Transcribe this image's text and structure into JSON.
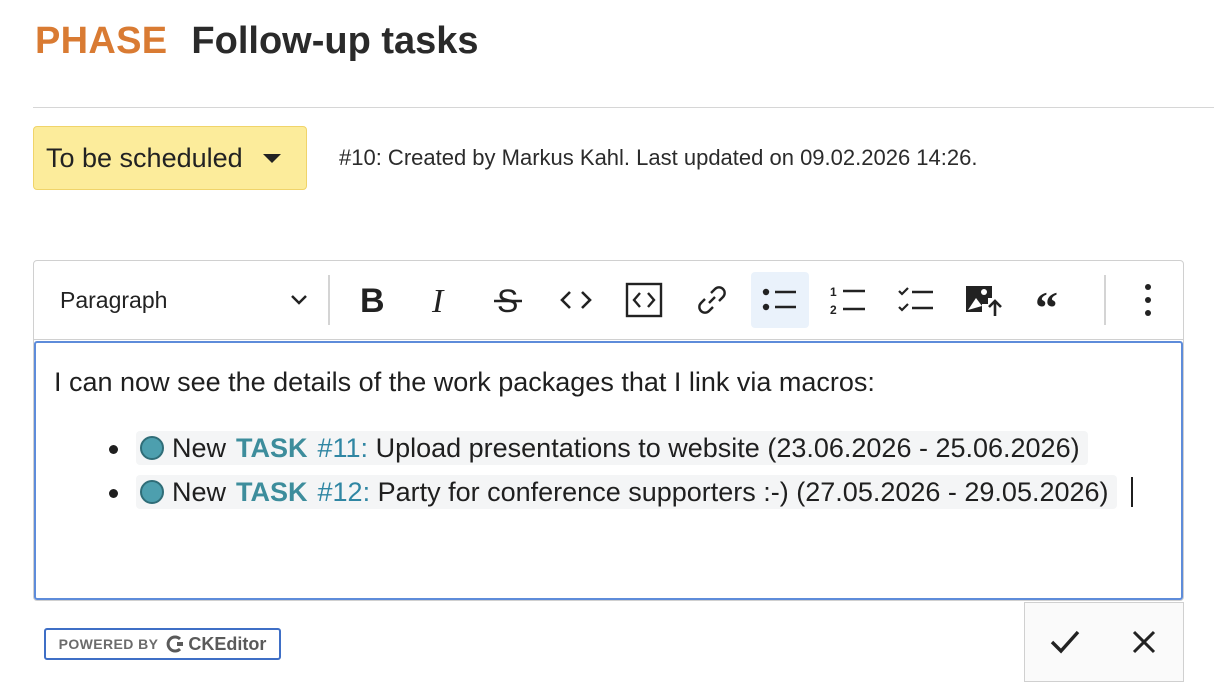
{
  "header": {
    "phase": "PHASE",
    "title": "Follow-up tasks"
  },
  "status": {
    "label": "To be scheduled",
    "color": "#fcec9b"
  },
  "meta": {
    "text": "#10: Created by Markus Kahl. Last updated on 09.02.2026 14:26."
  },
  "toolbar": {
    "paragraph_label": "Paragraph",
    "buttons": [
      "bold-icon",
      "italic-icon",
      "strikethrough-icon",
      "code-icon",
      "code-block-icon",
      "link-icon",
      "bulleted-list-icon",
      "numbered-list-icon",
      "todo-list-icon",
      "image-upload-icon",
      "blockquote-icon",
      "more-icon"
    ],
    "active": "bulleted-list-icon"
  },
  "content": {
    "intro": "I can now see the details of the work packages that I link via macros:",
    "items": [
      {
        "status": "New",
        "type": "TASK",
        "number": "#11:",
        "subject": "Upload presentations to website",
        "dates": "(23.06.2026 - 25.06.2026)"
      },
      {
        "status": "New",
        "type": "TASK",
        "number": "#12:",
        "subject": "Party for conference supporters :-)",
        "dates": "(27.05.2026 - 29.05.2026)"
      }
    ],
    "status_color": "#4d9fae"
  },
  "footer": {
    "powered_by": "POWERED BY",
    "brand": "CKEditor"
  }
}
